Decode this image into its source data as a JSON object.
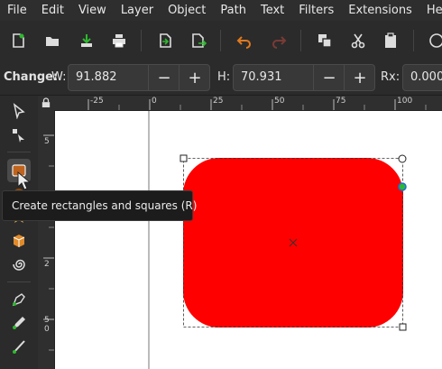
{
  "menubar": {
    "items": [
      "File",
      "Edit",
      "View",
      "Layer",
      "Object",
      "Path",
      "Text",
      "Filters",
      "Extensions",
      "Help"
    ]
  },
  "commandbar": {
    "icons": [
      "new-document-icon",
      "open-icon",
      "save-icon",
      "print-icon",
      "import-icon",
      "export-icon",
      "undo-icon",
      "redo-icon",
      "duplicate-icon",
      "cut-icon",
      "paste-icon"
    ]
  },
  "toolcontrols": {
    "change_label": "Change:",
    "w_label": "W:",
    "w_value": "91.882",
    "h_label": "H:",
    "h_value": "70.931",
    "rx_label": "Rx:",
    "rx_value": "0.000",
    "minus": "−",
    "plus": "+"
  },
  "ruler": {
    "top_labels": [
      "-25",
      "0",
      "25",
      "50",
      "75",
      "100"
    ],
    "left_labels": [
      "5",
      "2",
      "5",
      "0"
    ]
  },
  "tooltip": {
    "text": "Create rectangles and squares (R)"
  },
  "colors": {
    "rect_fill": "#ff0000",
    "ui_bg": "#2b2b2b",
    "accent": "#e07a1f",
    "node_green": "#2eb82e",
    "node_blue": "#1a6fd6"
  }
}
